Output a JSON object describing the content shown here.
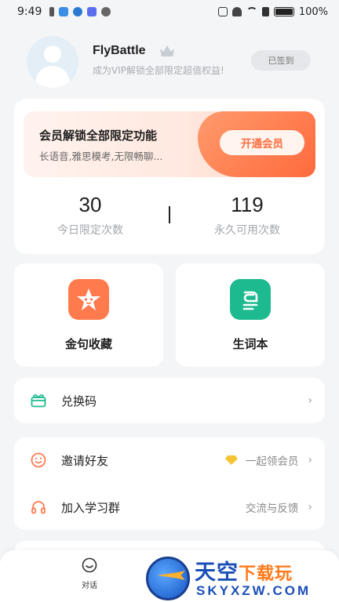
{
  "status_bar": {
    "time": "9:49",
    "battery": "100%",
    "battery_level": 1.0
  },
  "profile": {
    "username": "FlyBattle",
    "subtitle": "成为VIP解锁全部限定超值权益!",
    "signin_label": "已签到"
  },
  "vip": {
    "title": "会员解锁全部限定功能",
    "description": "长语音,雅思模考,无限畅聊...",
    "open_label": "开通会员",
    "stats": [
      {
        "value": "30",
        "label": "今日限定次数"
      },
      {
        "value": "119",
        "label": "永久可用次数"
      }
    ]
  },
  "tiles": [
    {
      "label": "金句收藏",
      "icon": "star-icon",
      "color": "#ff7a4d"
    },
    {
      "label": "生词本",
      "icon": "notebook-icon",
      "color": "#1dba8f"
    }
  ],
  "list": {
    "redeem": {
      "label": "兑换码",
      "icon": "gift-icon"
    },
    "invite": {
      "label": "邀请好友",
      "right": "一起领会员",
      "icon": "smile-icon"
    },
    "group": {
      "label": "加入学习群",
      "right": "交流与反馈",
      "icon": "headphones-icon"
    }
  },
  "bottom_nav": {
    "chat_label": "对话"
  },
  "watermark": {
    "title_a": "天空",
    "title_b": "下载玩",
    "subtitle": "SKYXZW.COM"
  },
  "colors": {
    "accent": "#ff6a3d",
    "green": "#1dba8f",
    "background": "#f4f5f7"
  }
}
